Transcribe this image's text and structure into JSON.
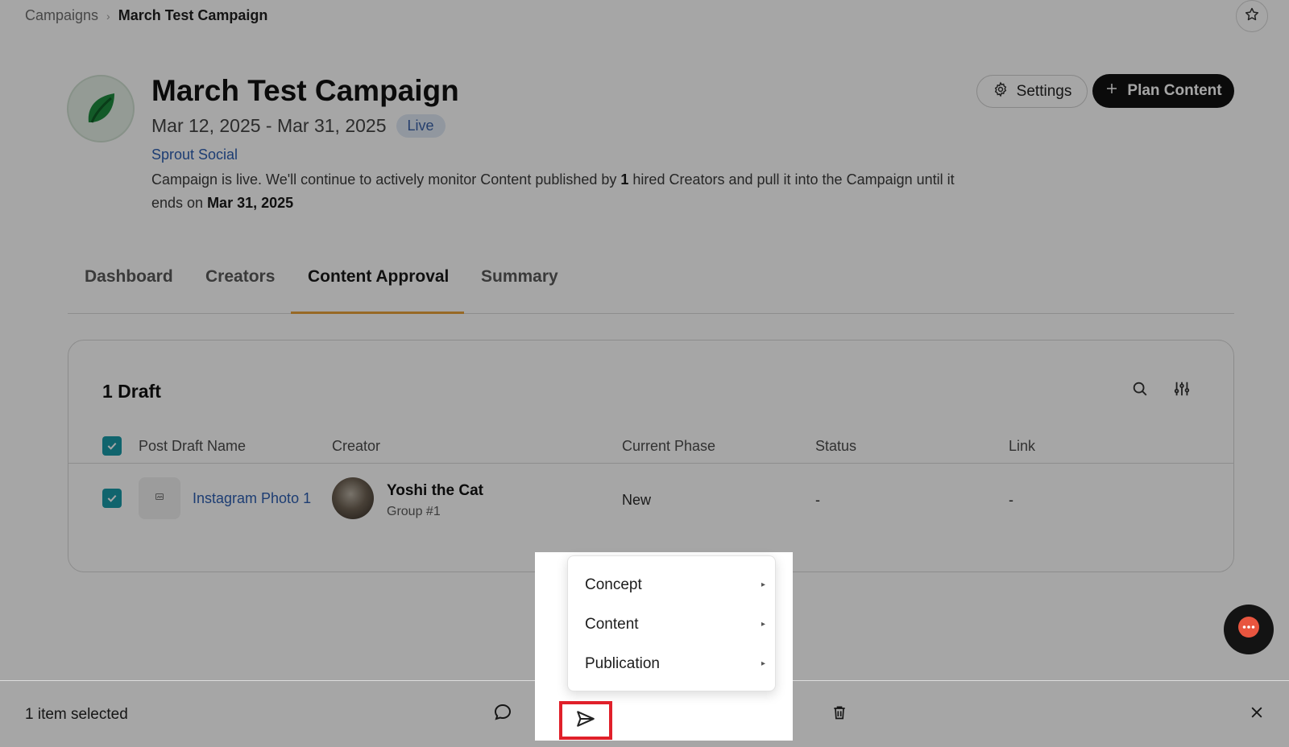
{
  "breadcrumb": {
    "parent": "Campaigns",
    "separator": "›",
    "current": "March Test Campaign"
  },
  "header": {
    "title": "March Test Campaign",
    "date_range": "Mar 12, 2025 - Mar 31, 2025",
    "status_badge": "Live",
    "brand": "Sprout Social",
    "description_part1": "Campaign is live. We'll continue to actively monitor Content published by ",
    "description_count": "1",
    "description_part2": " hired Creators and pull it into the Campaign until it ends on ",
    "description_end_date": "Mar 31, 2025",
    "settings_label": "Settings",
    "plan_content_label": "Plan Content"
  },
  "tabs": [
    {
      "label": "Dashboard"
    },
    {
      "label": "Creators"
    },
    {
      "label": "Content Approval",
      "active": true
    },
    {
      "label": "Summary"
    }
  ],
  "drafts": {
    "title": "1 Draft",
    "columns": [
      "Post Draft Name",
      "Creator",
      "Current Phase",
      "Status",
      "Link"
    ],
    "rows": [
      {
        "name": "Instagram Photo 1",
        "creator_name": "Yoshi the Cat",
        "creator_group": "Group #1",
        "phase": "New",
        "status": "-",
        "link": "-"
      }
    ]
  },
  "phase_menu": {
    "items": [
      {
        "label": "Concept",
        "caret": "▸"
      },
      {
        "label": "Content",
        "caret": "▸"
      },
      {
        "label": "Publication",
        "caret": "▸"
      }
    ]
  },
  "bottom_bar": {
    "selected_text": "1 item selected"
  },
  "icons": {
    "star": "star-icon",
    "gear": "gear-icon",
    "plus": "plus-icon",
    "search": "search-icon",
    "filters": "sliders-icon",
    "comment": "comment-icon",
    "send": "send-icon",
    "bell": "bell-icon",
    "calendar": "calendar-icon",
    "trash": "trash-icon",
    "close": "close-icon",
    "chat": "chat-icon"
  },
  "colors": {
    "accent_tab": "#e8a23b",
    "link": "#2d5fb1",
    "checkbox": "#1a9aa8",
    "highlight": "#e0202a",
    "primary_button": "#121212"
  }
}
